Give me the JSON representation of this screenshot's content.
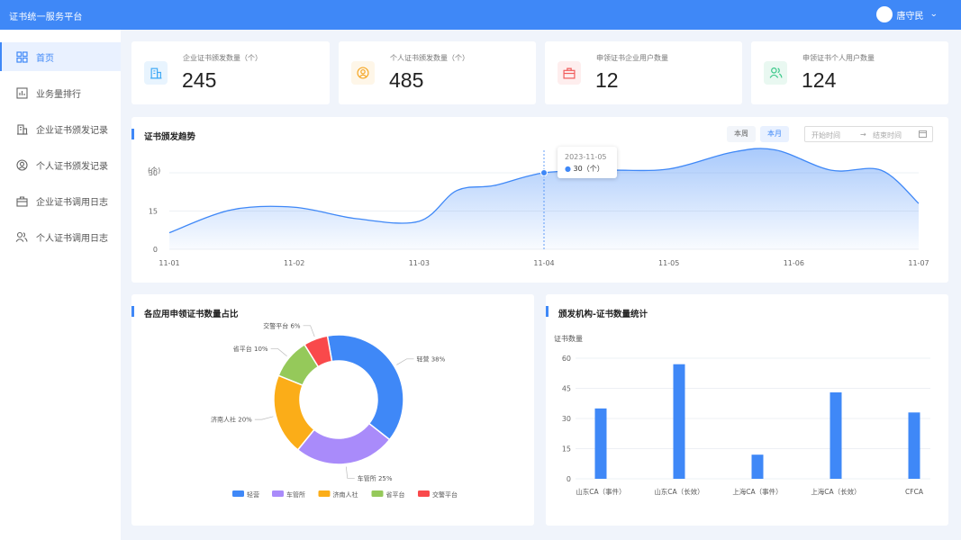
{
  "app": {
    "title": "证书统一服务平台"
  },
  "user": {
    "name": "唐守民"
  },
  "sidebar": {
    "items": [
      {
        "label": "首页",
        "icon": "grid-icon",
        "active": true
      },
      {
        "label": "业务量排行",
        "icon": "bar-chart-icon"
      },
      {
        "label": "企业证书颁发记录",
        "icon": "building-icon"
      },
      {
        "label": "个人证书颁发记录",
        "icon": "user-circle-icon"
      },
      {
        "label": "企业证书调用日志",
        "icon": "briefcase-icon"
      },
      {
        "label": "个人证书调用日志",
        "icon": "users-icon"
      }
    ]
  },
  "stats": [
    {
      "label": "企业证书颁发数量（个）",
      "value": "245",
      "icon": "building-icon",
      "color": "#3fa9f5",
      "bg": "#e8f4fe"
    },
    {
      "label": "个人证书颁发数量（个）",
      "value": "485",
      "icon": "user-circle-icon",
      "color": "#f5a623",
      "bg": "#fef6e8"
    },
    {
      "label": "申领证书企业用户数量",
      "value": "12",
      "icon": "briefcase-icon",
      "color": "#f05a5a",
      "bg": "#feeeee"
    },
    {
      "label": "申领证书个人用户数量",
      "value": "124",
      "icon": "users-icon",
      "color": "#3cc88a",
      "bg": "#e9f8f1"
    }
  ],
  "trend": {
    "title": "证书颁发趋势",
    "btn_week": "本周",
    "btn_month": "本月",
    "start_placeholder": "开始时间",
    "range_arrow": "→",
    "end_placeholder": "结束时间",
    "tooltip": {
      "date": "2023-11-05",
      "value": "30（个）"
    }
  },
  "pie_card": {
    "title": "各应用申领证书数量占比"
  },
  "bar_card": {
    "title": "颁发机构-证书数量统计"
  },
  "colors": {
    "accent": "#3f88f7"
  },
  "chart_data": [
    {
      "type": "area",
      "ylabel": "(个)",
      "x": [
        "11-01",
        "11-02",
        "11-03",
        "11-04",
        "11-05",
        "11-06",
        "11-07"
      ],
      "yticks": [
        0,
        15,
        30
      ],
      "ylim": [
        0,
        36
      ],
      "series": [
        {
          "values_x": [
            "11-01",
            "11-01.5",
            "11-02",
            "11-02.5",
            "11-03",
            "11-03.5",
            "11-04",
            "11-04.5",
            "11-05",
            "11-05.5",
            "11-06",
            "11-06.5",
            "11-07"
          ]
        }
      ],
      "points": [
        {
          "x": 0.0,
          "y": 6.5
        },
        {
          "x": 0.5,
          "y": 15.5
        },
        {
          "x": 1.0,
          "y": 16.5
        },
        {
          "x": 1.5,
          "y": 12.0
        },
        {
          "x": 2.0,
          "y": 11.0
        },
        {
          "x": 2.3,
          "y": 23.0
        },
        {
          "x": 2.6,
          "y": 25.0
        },
        {
          "x": 3.0,
          "y": 30.0
        },
        {
          "x": 3.5,
          "y": 31.0
        },
        {
          "x": 4.0,
          "y": 31.5
        },
        {
          "x": 4.5,
          "y": 38.0
        },
        {
          "x": 4.85,
          "y": 39.0
        },
        {
          "x": 5.3,
          "y": 31.0
        },
        {
          "x": 5.7,
          "y": 31.0
        },
        {
          "x": 6.0,
          "y": 18.0
        }
      ],
      "highlight": {
        "x": 3.0,
        "y": 30
      }
    },
    {
      "type": "pie",
      "slices": [
        {
          "name": "轻营",
          "value": 38,
          "label": "轻营  38%",
          "color": "#3f88f7"
        },
        {
          "name": "车管所",
          "value": 25,
          "label": "车管所  25%",
          "color": "#a98bfa"
        },
        {
          "name": "济南人社",
          "value": 20,
          "label": "济南人社  20%",
          "color": "#fbad18"
        },
        {
          "name": "省平台",
          "value": 10,
          "label": "省平台  10%",
          "color": "#95c95a"
        },
        {
          "name": "交警平台",
          "value": 6,
          "label": "交警平台  6%",
          "color": "#f9494b"
        }
      ],
      "legend": [
        "轻营",
        "车管所",
        "济南人社",
        "省平台",
        "交警平台"
      ]
    },
    {
      "type": "bar",
      "ylabel": "证书数量",
      "categories": [
        "山东CA（事件）",
        "山东CA（长效）",
        "上海CA（事件）",
        "上海CA（长效）",
        "CFCA"
      ],
      "values": [
        35,
        57,
        12,
        43,
        33
      ],
      "yticks": [
        0,
        15,
        30,
        45,
        60
      ],
      "ylim": [
        0,
        60
      ],
      "color": "#3f88f7"
    }
  ]
}
